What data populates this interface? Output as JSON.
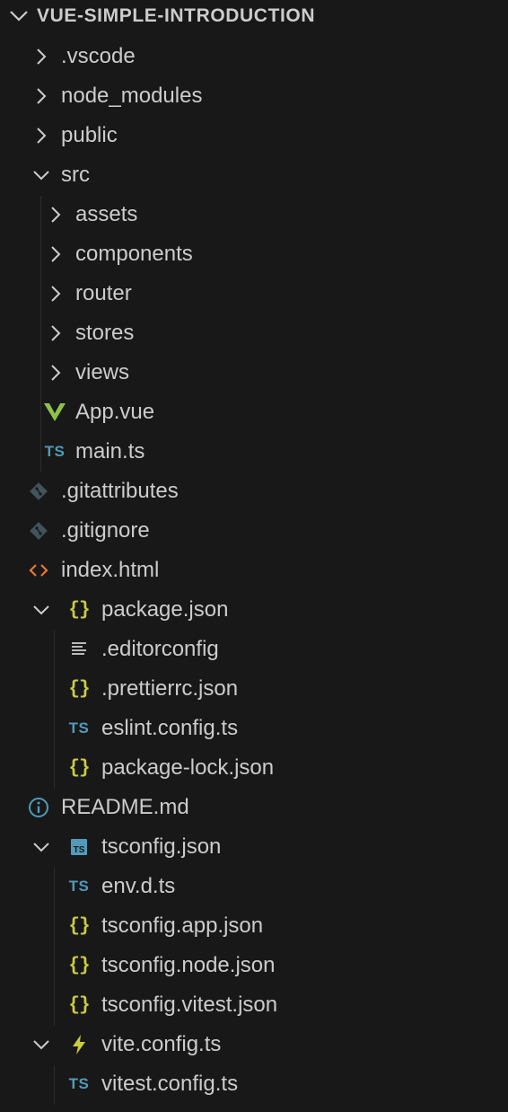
{
  "explorer": {
    "root": {
      "label": "VUE-SIMPLE-INTRODUCTION"
    },
    "items": [
      {
        "label": ".vscode",
        "kind": "folder",
        "expanded": false,
        "depth": 0,
        "icon": "chevron-right-icon"
      },
      {
        "label": "node_modules",
        "kind": "folder",
        "expanded": false,
        "depth": 0,
        "icon": "chevron-right-icon"
      },
      {
        "label": "public",
        "kind": "folder",
        "expanded": false,
        "depth": 0,
        "icon": "chevron-right-icon"
      },
      {
        "label": "src",
        "kind": "folder",
        "expanded": true,
        "depth": 0,
        "icon": "chevron-down-icon"
      },
      {
        "label": "assets",
        "kind": "folder",
        "expanded": false,
        "depth": 1,
        "icon": "chevron-right-icon"
      },
      {
        "label": "components",
        "kind": "folder",
        "expanded": false,
        "depth": 1,
        "icon": "chevron-right-icon"
      },
      {
        "label": "router",
        "kind": "folder",
        "expanded": false,
        "depth": 1,
        "icon": "chevron-right-icon"
      },
      {
        "label": "stores",
        "kind": "folder",
        "expanded": false,
        "depth": 1,
        "icon": "chevron-right-icon"
      },
      {
        "label": "views",
        "kind": "folder",
        "expanded": false,
        "depth": 1,
        "icon": "chevron-right-icon"
      },
      {
        "label": "App.vue",
        "kind": "file",
        "depth": 1,
        "icon": "vue-icon"
      },
      {
        "label": "main.ts",
        "kind": "file",
        "depth": 1,
        "icon": "typescript-icon",
        "icon_text": "TS"
      },
      {
        "label": ".gitattributes",
        "kind": "file",
        "depth": 0,
        "icon": "git-icon"
      },
      {
        "label": ".gitignore",
        "kind": "file",
        "depth": 0,
        "icon": "git-icon"
      },
      {
        "label": "index.html",
        "kind": "file",
        "depth": 0,
        "icon": "html-icon"
      },
      {
        "label": "package.json",
        "kind": "file-nest",
        "expanded": true,
        "depth": 0,
        "icon": "json-icon",
        "icon_text": "{}"
      },
      {
        "label": ".editorconfig",
        "kind": "file",
        "depth": 1,
        "icon": "config-lines-icon"
      },
      {
        "label": ".prettierrc.json",
        "kind": "file",
        "depth": 1,
        "icon": "json-icon",
        "icon_text": "{}"
      },
      {
        "label": "eslint.config.ts",
        "kind": "file",
        "depth": 1,
        "icon": "typescript-icon",
        "icon_text": "TS"
      },
      {
        "label": "package-lock.json",
        "kind": "file",
        "depth": 1,
        "icon": "json-icon",
        "icon_text": "{}"
      },
      {
        "label": "README.md",
        "kind": "file",
        "depth": 0,
        "icon": "info-icon"
      },
      {
        "label": "tsconfig.json",
        "kind": "file-nest",
        "expanded": true,
        "depth": 0,
        "icon": "tsconfig-icon"
      },
      {
        "label": "env.d.ts",
        "kind": "file",
        "depth": 1,
        "icon": "typescript-icon",
        "icon_text": "TS"
      },
      {
        "label": "tsconfig.app.json",
        "kind": "file",
        "depth": 1,
        "icon": "json-icon",
        "icon_text": "{}"
      },
      {
        "label": "tsconfig.node.json",
        "kind": "file",
        "depth": 1,
        "icon": "json-icon",
        "icon_text": "{}"
      },
      {
        "label": "tsconfig.vitest.json",
        "kind": "file",
        "depth": 1,
        "icon": "json-icon",
        "icon_text": "{}"
      },
      {
        "label": "vite.config.ts",
        "kind": "file-nest",
        "expanded": true,
        "depth": 0,
        "icon": "vite-icon"
      },
      {
        "label": "vitest.config.ts",
        "kind": "file",
        "depth": 1,
        "icon": "typescript-icon",
        "icon_text": "TS"
      }
    ]
  },
  "colors": {
    "background": "#181818",
    "text": "#cccccc",
    "ts_blue": "#519aba",
    "json_yellow": "#cbcb41",
    "vue_green": "#8dc149",
    "html_orange": "#e37933",
    "git_gray": "#41535b",
    "info_blue": "#519aba"
  }
}
